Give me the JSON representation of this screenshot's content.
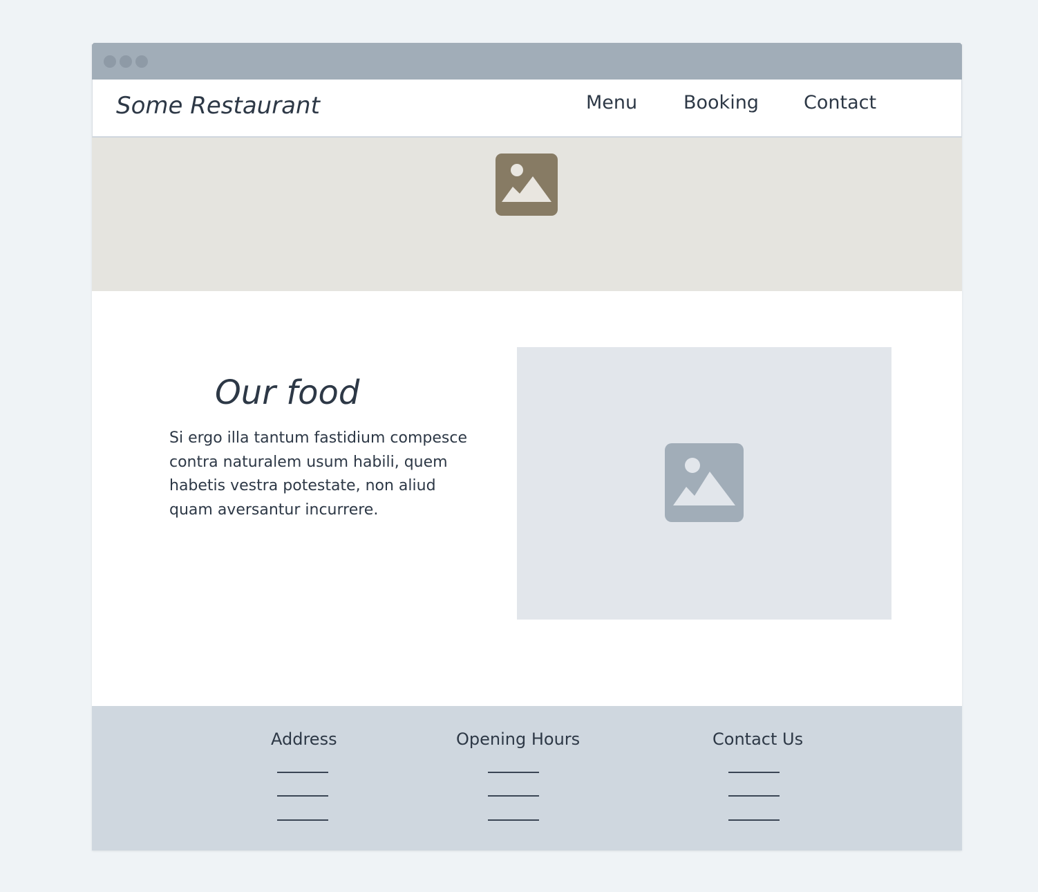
{
  "window": {
    "controls": [
      "close-dot",
      "minimize-dot",
      "maximize-dot"
    ]
  },
  "navbar": {
    "brand": "Some Restaurant",
    "links": [
      {
        "label": "Menu"
      },
      {
        "label": "Booking"
      },
      {
        "label": "Contact"
      }
    ]
  },
  "hero": {
    "icon": "image-placeholder-icon",
    "background_color": "#e5e4df",
    "icon_color": "#877b64"
  },
  "main": {
    "title": "Our food",
    "paragraph": "Si ergo illa tantum fastidium compesce contra naturalem usum habili, quem habetis vestra potestate, non aliud quam aversantur incurrere.",
    "image_icon": "image-placeholder-icon",
    "image_color": "#e2e6eb"
  },
  "footer": {
    "background_color": "#cfd7df",
    "columns": [
      {
        "heading": "Address"
      },
      {
        "heading": "Opening Hours"
      },
      {
        "heading": "Contact Us"
      }
    ]
  }
}
